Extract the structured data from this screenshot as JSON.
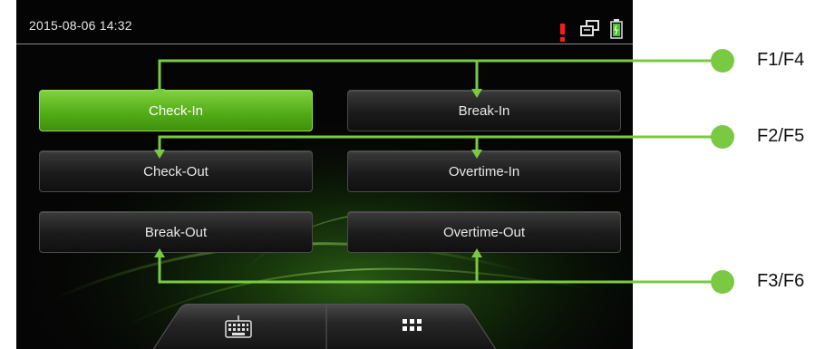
{
  "status_bar": {
    "datetime": "2015-08-06 14:32"
  },
  "status_icons": [
    "alert-icon",
    "network-icon",
    "battery-icon"
  ],
  "state_buttons": [
    {
      "label": "Check-In",
      "selected": true
    },
    {
      "label": "Break-In",
      "selected": false
    },
    {
      "label": "Check-Out",
      "selected": false
    },
    {
      "label": "Overtime-In",
      "selected": false
    },
    {
      "label": "Break-Out",
      "selected": false
    },
    {
      "label": "Overtime-Out",
      "selected": false
    }
  ],
  "bottom_bar": {
    "icons": [
      "keyboard-icon",
      "grid-menu-icon"
    ]
  },
  "function_keys": [
    "F1/F4",
    "F2/F5",
    "F3/F6"
  ],
  "colors": {
    "accent_green": "#7ac943",
    "selected_button": "#5bb51f",
    "alert_red": "#ff1a1a",
    "callout_line": "#7ac943"
  }
}
